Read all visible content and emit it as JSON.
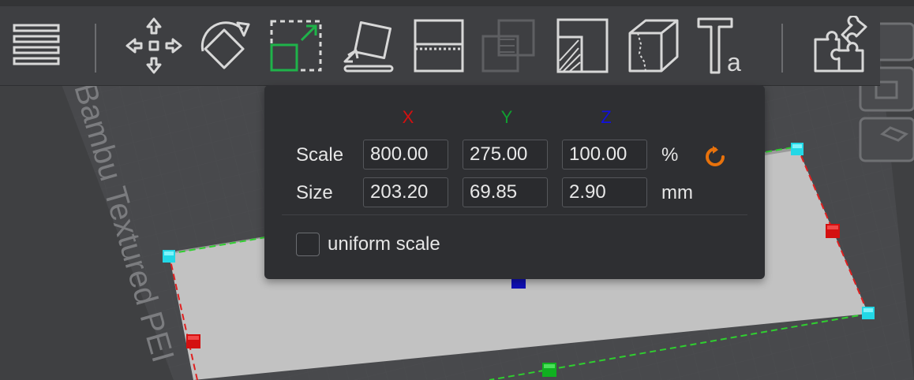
{
  "toolbar": {
    "tools": [
      {
        "name": "menu",
        "icon": "hamburger-menu-icon"
      },
      {
        "name": "move",
        "icon": "move-arrows-icon"
      },
      {
        "name": "rotate",
        "icon": "rotate-icon"
      },
      {
        "name": "scale",
        "icon": "scale-icon",
        "active": true
      },
      {
        "name": "lay-on-face",
        "icon": "lay-on-face-icon"
      },
      {
        "name": "cut",
        "icon": "cut-icon"
      },
      {
        "name": "boolean",
        "icon": "boolean-icon",
        "disabled": true
      },
      {
        "name": "support-painting",
        "icon": "support-paint-icon"
      },
      {
        "name": "seam-painting",
        "icon": "seam-paint-icon"
      },
      {
        "name": "text",
        "icon": "text-shape-icon"
      },
      {
        "name": "assembly",
        "icon": "puzzle-assembly-icon"
      }
    ]
  },
  "scene": {
    "plate_label": "Bambu Textured PEI"
  },
  "scale_panel": {
    "axes": {
      "x": "X",
      "y": "Y",
      "z": "Z"
    },
    "scale_label": "Scale",
    "size_label": "Size",
    "scale": {
      "x": "800.00",
      "y": "275.00",
      "z": "100.00"
    },
    "size": {
      "x": "203.20",
      "y": "69.85",
      "z": "2.90"
    },
    "scale_unit": "%",
    "size_unit": "mm",
    "reset_icon": "reset-rotate-icon",
    "uniform_scale_label": "uniform scale",
    "uniform_scale_checked": false
  },
  "colors": {
    "axis_x": "#d41010",
    "axis_y": "#10a030",
    "axis_z": "#1010e0",
    "accent": "#e8720c",
    "active_tool": "#1fb34a"
  }
}
